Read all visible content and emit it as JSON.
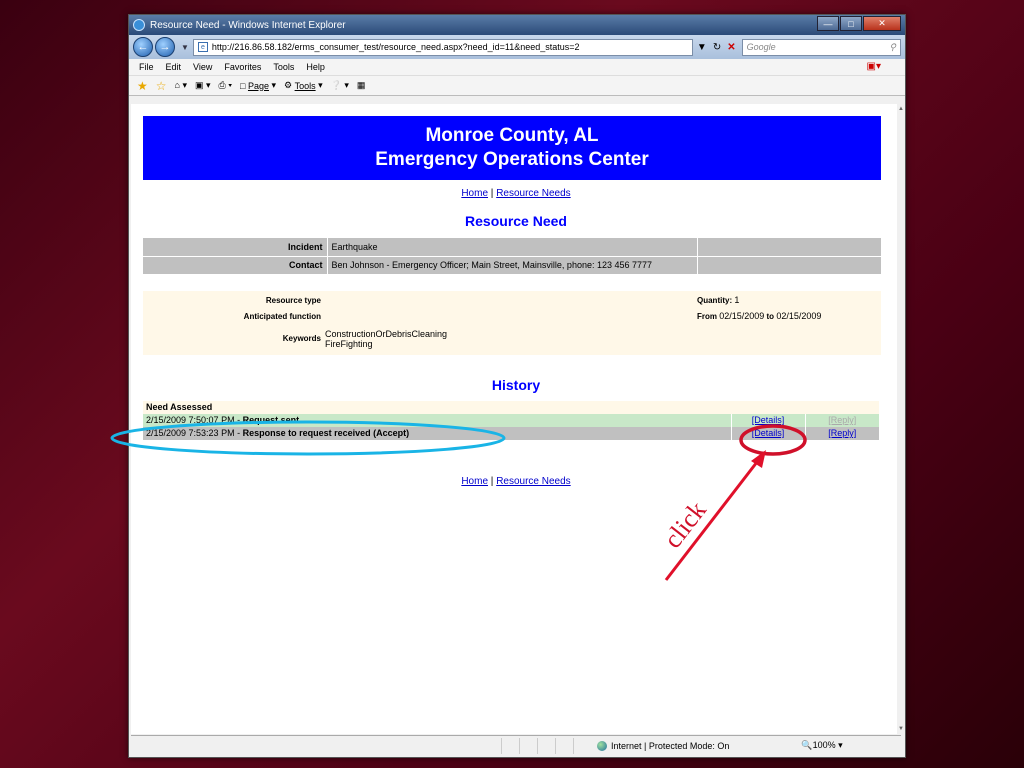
{
  "browser": {
    "title": "Resource Need - Windows Internet Explorer",
    "url": "http://216.86.58.182/erms_consumer_test/resource_need.aspx?need_id=11&need_status=2",
    "search_placeholder": "Google",
    "menu": [
      "File",
      "Edit",
      "View",
      "Favorites",
      "Tools",
      "Help"
    ],
    "commands": {
      "page": "Page",
      "tools": "Tools"
    },
    "status": {
      "zone": "Internet | Protected Mode: On",
      "zoom": "100%"
    }
  },
  "header": {
    "line1": "Monroe County, AL",
    "line2": "Emergency Operations Center"
  },
  "nav": {
    "home": "Home",
    "sep": "|",
    "resource_needs": "Resource Needs"
  },
  "resource_need": {
    "title": "Resource Need",
    "incident_label": "Incident",
    "incident_value": "Earthquake",
    "contact_label": "Contact",
    "contact_value": "Ben Johnson - Emergency Officer;  Main Street, Mainsville, phone: 123 456 7777",
    "resource_type_label": "Resource type",
    "anticipated_function_label": "Anticipated function",
    "keywords_label": "Keywords",
    "keywords": [
      "ConstructionOrDebrisCleaning",
      "FireFighting"
    ],
    "quantity_label": "Quantity:",
    "quantity_value": "1",
    "from_label": "From",
    "from_value": "02/15/2009",
    "to_label": "to",
    "to_value": "02/15/2009"
  },
  "history": {
    "title": "History",
    "group": "Need Assessed",
    "rows": [
      {
        "time": "2/15/2009 7:50:07 PM - ",
        "event": "Request sent",
        "details": "[Details]",
        "reply": "[Reply]"
      },
      {
        "time": "2/15/2009 7:53:23 PM - ",
        "event": "Response to request received (Accept)",
        "details": "[Details]",
        "reply": "[Reply]"
      }
    ]
  },
  "annotation": {
    "text": "click",
    "color": "#d0102a",
    "ellipse_color": "#19b4e6"
  }
}
